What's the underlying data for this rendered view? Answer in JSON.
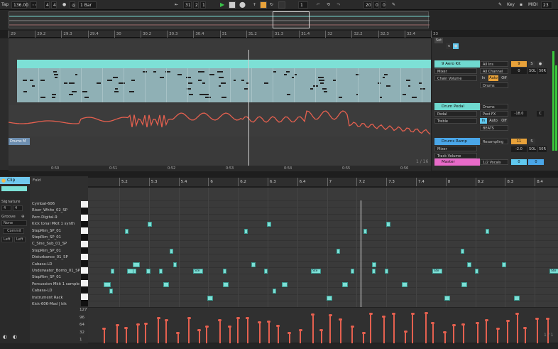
{
  "transport": {
    "tap": "Tap",
    "tempo": "136.00",
    "sig_num": "4",
    "sig_den": "4",
    "quantize": "1 Bar",
    "position": [
      "31",
      "2",
      "1"
    ],
    "loop_start": [
      "1"
    ],
    "loop_len": [
      "20",
      "0",
      "0"
    ],
    "key_label": "Key",
    "midi_label": "MIDI",
    "cpu": "23 %"
  },
  "arrangement": {
    "ruler": [
      "29",
      "29.2",
      "29.3",
      "29.4",
      "30",
      "30.2",
      "30.3",
      "30.4",
      "31",
      "31.2",
      "31.3",
      "31.4",
      "32",
      "32.2",
      "32.3",
      "32.4",
      "33"
    ],
    "time_ruler": [
      "0:50",
      "0:51",
      "0:52",
      "0:53",
      "0:54",
      "0:55",
      "0:56"
    ],
    "drums_tab": "Drums M",
    "page_counter": "1 / 16"
  },
  "mixer": {
    "set_label": "Set",
    "tracks": [
      {
        "name": "9 Aero Kit",
        "color": "#6fd9cf",
        "routing": "All Ins",
        "channel": "All Channel",
        "monitor": [
          "In",
          "Auto",
          "Off"
        ],
        "out": "Drums",
        "chain": "Chain Volume",
        "mixer": "Mixer",
        "num": "9",
        "s": "S",
        "vol": "0",
        "c": "C",
        "v2": "SOL",
        "v3": "50R"
      },
      {
        "name": "Drum Pedal",
        "color": "#6fd9cf",
        "routing": "Drums",
        "channel": "Post FX",
        "monitor": [
          "In",
          "Auto",
          "Off"
        ],
        "out": "BEATS",
        "pedal": "Pedal",
        "treble": "Treble",
        "vol": "-18.0",
        "c": "C"
      },
      {
        "name": "Drums Ramp",
        "color": "#4aa6e8",
        "routing": "Resampling",
        "mixer": "Mixer",
        "chain": "Track Volume",
        "num": "11",
        "s": "S",
        "vol": "-2.0",
        "v2": "SOL",
        "v3": "50R"
      },
      {
        "name": "Master",
        "color": "#e86bc9",
        "routing": "1/2 Vocals",
        "vol": "0",
        "v2": "0"
      }
    ]
  },
  "clip": {
    "tab": "Clip",
    "fold": "Fold",
    "signature_label": "Signature",
    "sig_num": "4",
    "sig_den": "4",
    "groove_label": "Groove",
    "groove_value": "None",
    "commit": "Commit",
    "btn1": "Left",
    "btn2": "Left",
    "ruler": [
      "5.2",
      "5.3",
      "5.4",
      "6",
      "6.2",
      "6.3",
      "6.4",
      "7",
      "7.2",
      "7.3",
      "7.4",
      "8",
      "8.2",
      "8.3",
      "8.4"
    ],
    "rows": [
      "Cymbal-606",
      "Riser_White_02_SP",
      "Perc-Digital-9",
      "Kick tonal Mkit 1 synth",
      "StepRim_SP_01",
      "StepRim_SP_01",
      "C_Sine_Sub_01_SP",
      "StepRim_SP_01",
      "Disturbance_01_SP",
      "Cabasa-LD",
      "Underwater_Bomb_01_SP",
      "StepRim_SP_01",
      "Percussion Mkit 1 sample",
      "Cabasa-LD",
      "Instrument Rack",
      "Kick-606-Mod | kik"
    ],
    "note_label": "Ste",
    "vel_ticks": [
      "127",
      "96",
      "64",
      "32",
      "1"
    ],
    "page_counter": "1 / 1"
  },
  "colors": {
    "accent_cyan": "#7de0d6",
    "automation": "#e5604f",
    "velocity": "#e5604f",
    "play": "#3ac24a"
  }
}
